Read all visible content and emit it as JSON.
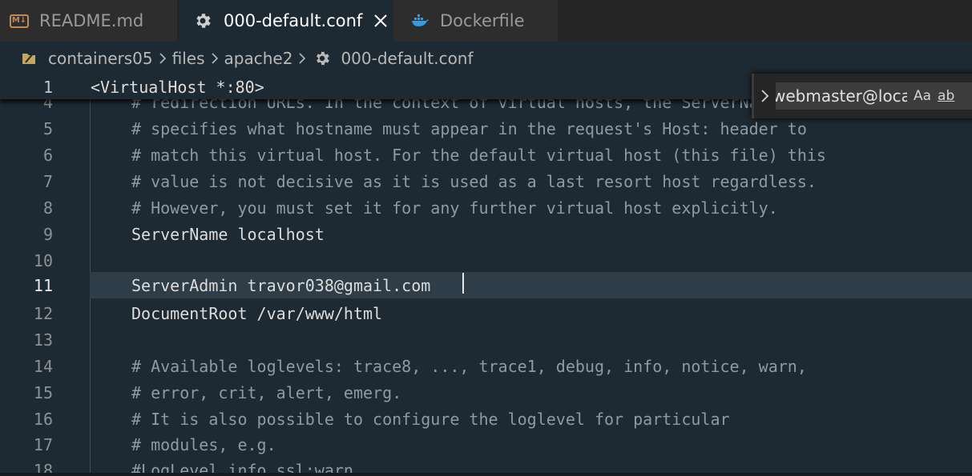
{
  "tabs": [
    {
      "label": "README.md",
      "icon": "markdown-icon",
      "badge": "M↓",
      "active": false
    },
    {
      "label": "000-default.conf",
      "icon": "gear-icon",
      "active": true
    },
    {
      "label": "Dockerfile",
      "icon": "docker-icon",
      "active": false
    }
  ],
  "breadcrumb": {
    "items": [
      "containers05",
      "files",
      "apache2",
      "000-default.conf"
    ]
  },
  "editor": {
    "sticky": {
      "number": "1",
      "text": "<VirtualHost *:80>"
    },
    "lines": [
      {
        "number": "4",
        "text": "# redirection URLs. In the context of virtual hosts, the ServerName",
        "comment": true
      },
      {
        "number": "5",
        "text": "# specifies what hostname must appear in the request's Host: header to",
        "comment": true
      },
      {
        "number": "6",
        "text": "# match this virtual host. For the default virtual host (this file) this",
        "comment": true
      },
      {
        "number": "7",
        "text": "# value is not decisive as it is used as a last resort host regardless.",
        "comment": true
      },
      {
        "number": "8",
        "text": "# However, you must set it for any further virtual host explicitly.",
        "comment": true
      },
      {
        "number": "9",
        "text": "ServerName localhost",
        "comment": false
      },
      {
        "number": "10",
        "text": "",
        "comment": false
      },
      {
        "number": "11",
        "text": "ServerAdmin travor038@gmail.com",
        "comment": false,
        "current": true
      },
      {
        "number": "12",
        "text": "DocumentRoot /var/www/html",
        "comment": false
      },
      {
        "number": "13",
        "text": "",
        "comment": false
      },
      {
        "number": "14",
        "text": "# Available loglevels: trace8, ..., trace1, debug, info, notice, warn,",
        "comment": true
      },
      {
        "number": "15",
        "text": "# error, crit, alert, emerg.",
        "comment": true
      },
      {
        "number": "16",
        "text": "# It is also possible to configure the loglevel for particular",
        "comment": true
      },
      {
        "number": "17",
        "text": "# modules, e.g.",
        "comment": true
      },
      {
        "number": "18",
        "text": "#LogLevel info ssl:warn",
        "comment": true
      }
    ]
  },
  "find": {
    "value": "webmaster@localhost",
    "match_case_label": "Aa",
    "whole_word_label": "ab"
  },
  "colors": {
    "editor_bg": "#1e2a33",
    "current_line": "#2e3d47",
    "comment": "#8e9aa2",
    "text": "#dcdcdc"
  }
}
